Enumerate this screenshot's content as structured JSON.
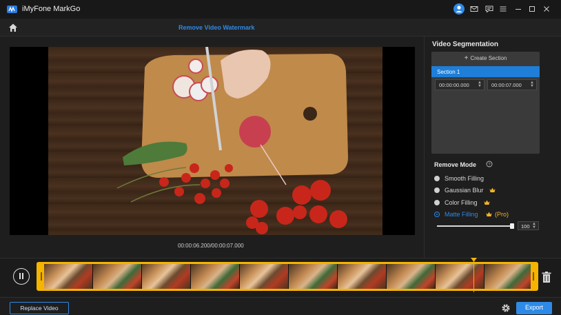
{
  "app": {
    "title": "iMyFone MarkGo"
  },
  "titlebar": {
    "icons": [
      "account-icon",
      "mail-icon",
      "feedback-icon",
      "menu-icon",
      "minimize-icon",
      "maximize-icon",
      "close-icon"
    ]
  },
  "header": {
    "title": "Remove Video Watermark",
    "home_icon": "home-icon"
  },
  "player": {
    "time_readout": "00:00:06.200/00:00:07.000"
  },
  "segmentation": {
    "title": "Video Segmentation",
    "create_label": "Create Section",
    "sections": [
      {
        "label": "Section 1",
        "start": "00:00:00.000",
        "end": "00:00:07.000"
      }
    ]
  },
  "remove_mode": {
    "title": "Remove Mode",
    "options": [
      {
        "label": "Smooth Filling",
        "selected": false,
        "premium": false
      },
      {
        "label": "Gaussian Blur",
        "selected": false,
        "premium": true
      },
      {
        "label": "Color Filling",
        "selected": false,
        "premium": true
      },
      {
        "label": "Matte Filling",
        "selected": true,
        "premium": true,
        "tag": "(Pro)"
      }
    ],
    "slider_value": "100",
    "slider_fraction": 1.0
  },
  "timeline": {
    "frame_count": 10,
    "playhead_fraction": 0.89
  },
  "footer": {
    "replace_label": "Replace Video",
    "export_label": "Export"
  },
  "colors": {
    "accent": "#2e8ae6",
    "highlight": "#f5b400",
    "premium": "#f0b429"
  }
}
